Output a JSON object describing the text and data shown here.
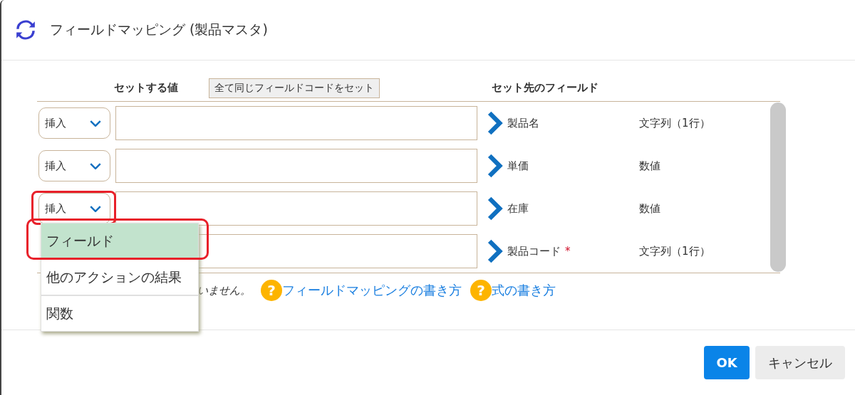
{
  "dialog": {
    "title": "フィールドマッピング (製品マスタ)"
  },
  "columns": {
    "value_heading": "セットする値",
    "set_all_button": "全て同じフィールドコードをセット",
    "target_heading": "セット先のフィールド"
  },
  "rows": [
    {
      "mode": "挿入",
      "value": "",
      "field": "製品名",
      "type": "文字列（1行）",
      "highlighted": false
    },
    {
      "mode": "挿入",
      "value": "",
      "field": "単価",
      "type": "数値",
      "highlighted": false
    },
    {
      "mode": "挿入",
      "value": "",
      "field": "在庫",
      "type": "数値",
      "highlighted": true
    },
    {
      "value": "",
      "field": "製品コード",
      "required_mark": "*",
      "type": "文字列（1行）"
    }
  ],
  "dropdown": {
    "options": [
      {
        "label": "フィールド",
        "selected": true,
        "highlighted": true
      },
      {
        "label": "他のアクションの結果",
        "selected": false,
        "highlighted": false
      },
      {
        "label": "関数",
        "selected": false,
        "highlighted": false
      }
    ]
  },
  "note": "いません。",
  "help_links": [
    "フィールドマッピングの書き方",
    "式の書き方"
  ],
  "help_icon_glyph": "?",
  "buttons": [
    {
      "label": "OK",
      "kind": "primary"
    },
    {
      "label": "キャンセル",
      "kind": "secondary"
    }
  ]
}
